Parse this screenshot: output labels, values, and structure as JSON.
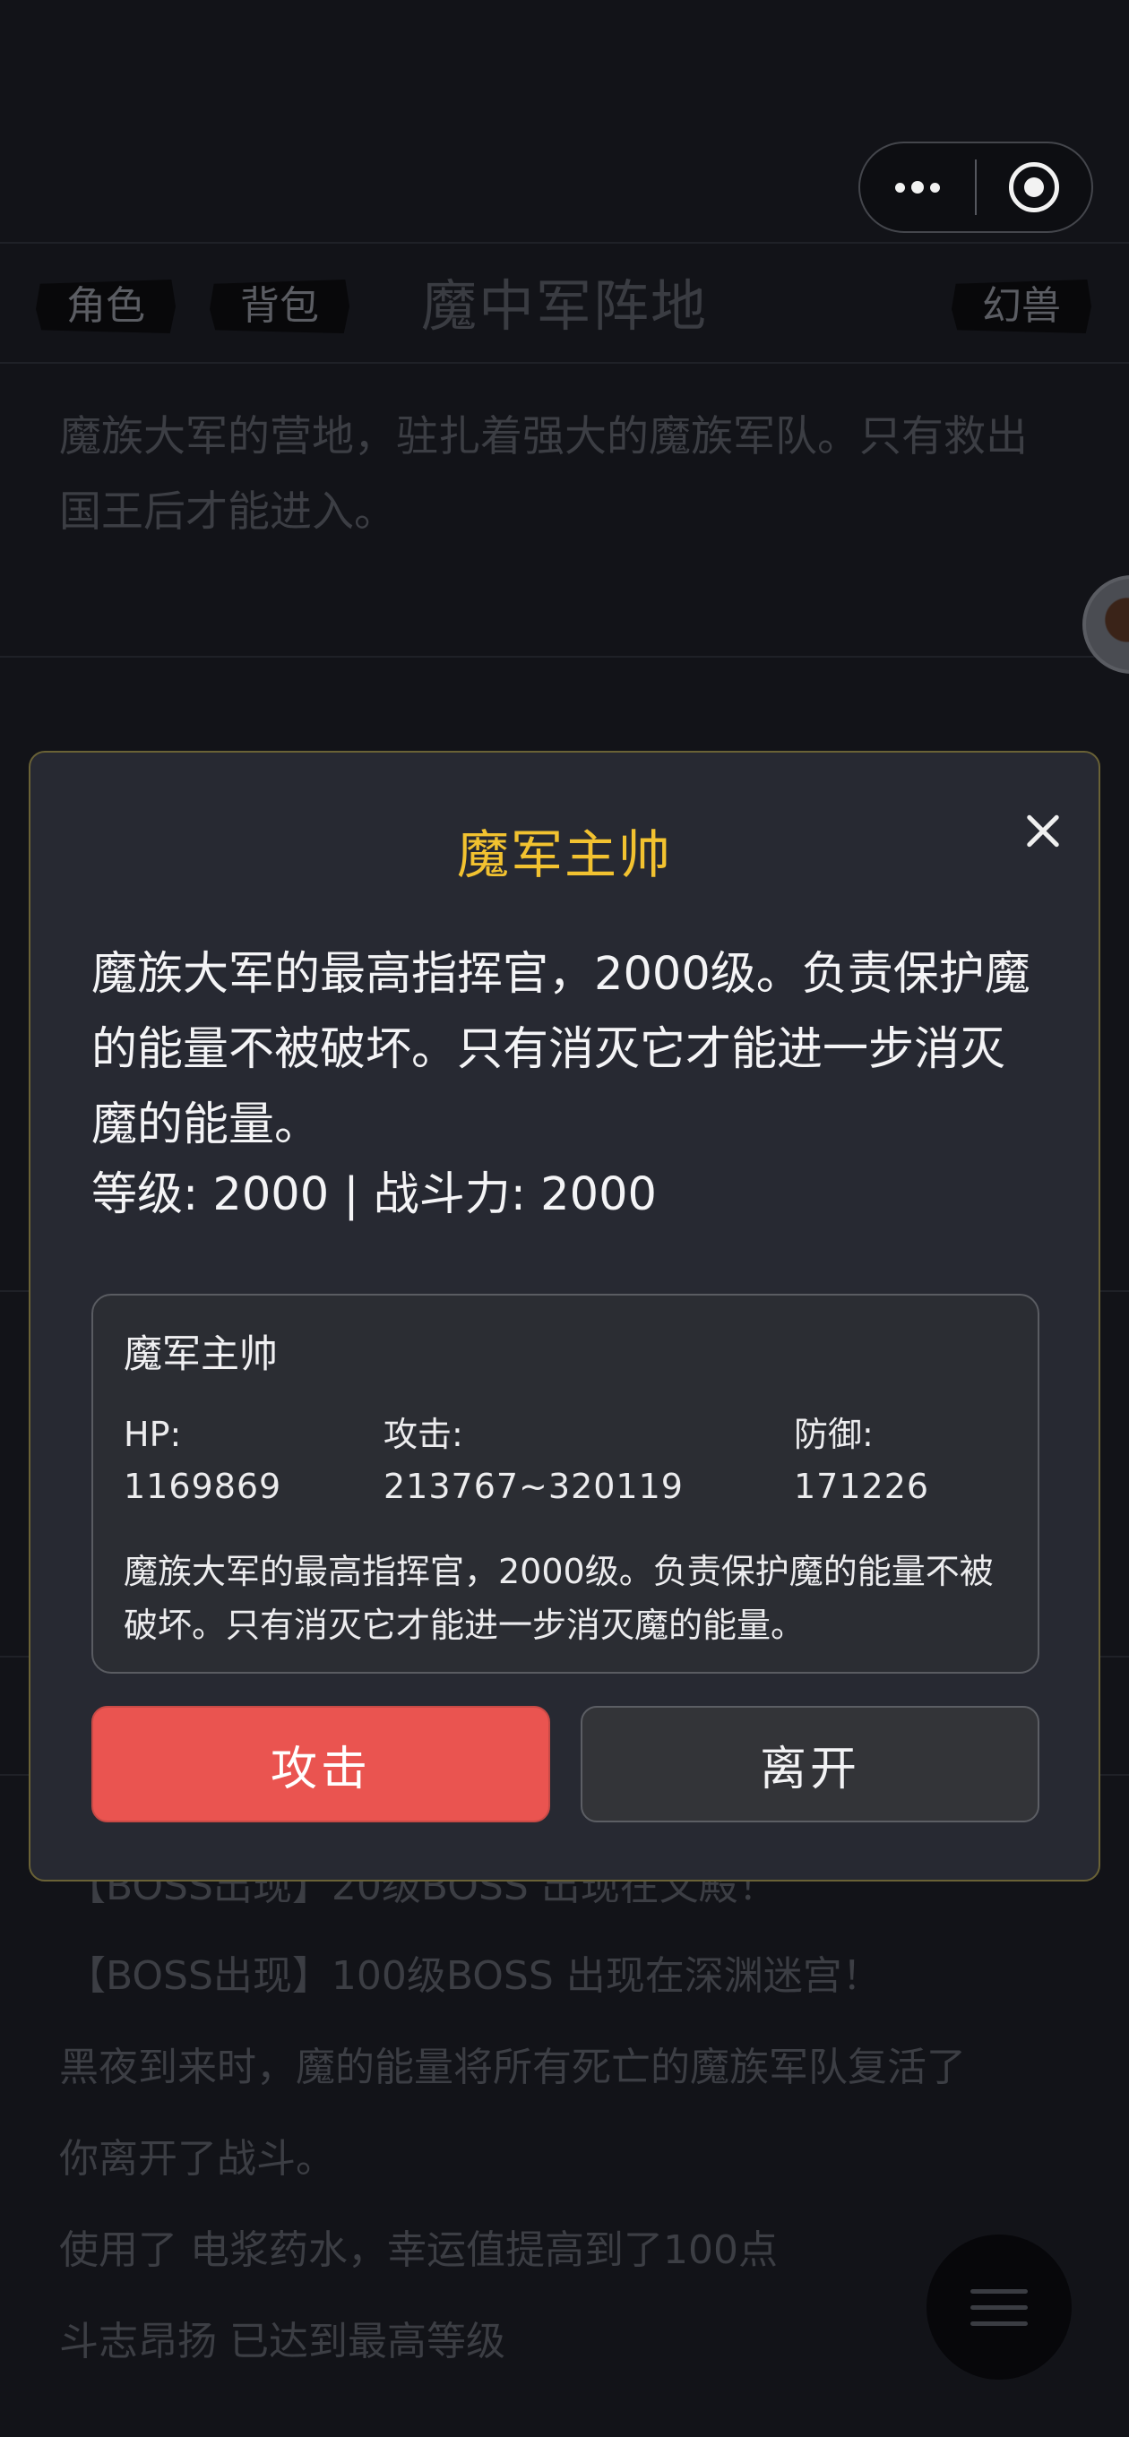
{
  "capsule": {
    "more_icon": "more-dots-icon",
    "close_icon": "target-circle-icon"
  },
  "nav": {
    "tab_role": "角色",
    "tab_bag": "背包",
    "title": "魔中军阵地",
    "tab_beast": "幻兽"
  },
  "scene_description": "魔族大军的营地，驻扎着强大的魔族军队。只有救出国王后才能进入。",
  "log": [
    "【BOSS出现】20级BOSS 出现在文殿！",
    "【BOSS出现】100级BOSS 出现在深渊迷宫！",
    "黑夜到来时，魔的能量将所有死亡的魔族军队复活了",
    "你离开了战斗。",
    "使用了 电浆药水，幸运值提高到了100点",
    "斗志昂扬 已达到最高等级"
  ],
  "modal": {
    "title": "魔军主帅",
    "description": "魔族大军的最高指挥官，2000级。负责保护魔的能量不被破坏。只有消灭它才能进一步消灭魔的能量。",
    "stats_line": "等级: 2000 | 战斗力: 2000",
    "card": {
      "name": "魔军主帅",
      "hp_label": "HP:",
      "hp_value": "1169869",
      "attack_label": "攻击:",
      "attack_value": "213767~320119",
      "defense_label": "防御:",
      "defense_value": "171226",
      "description": "魔族大军的最高指挥官，2000级。负责保护魔的能量不被破坏。只有消灭它才能进一步消灭魔的能量。"
    },
    "attack_button": "攻击",
    "leave_button": "离开"
  },
  "colors": {
    "background": "#121318",
    "modal_bg": "#272932",
    "title_gold": "#f2c230",
    "attack_red": "#ea5450"
  }
}
